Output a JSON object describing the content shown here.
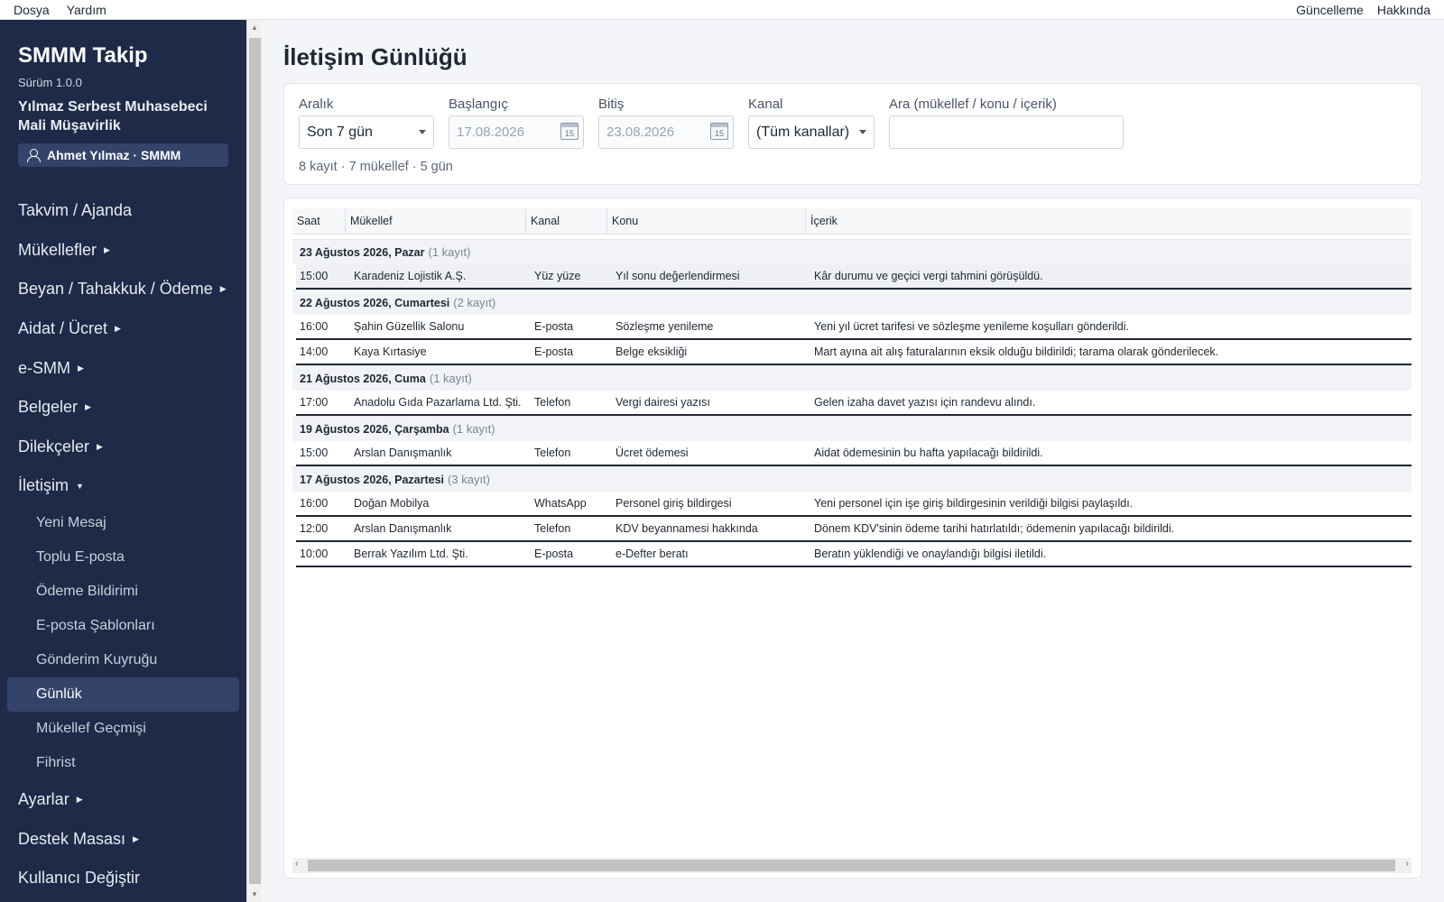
{
  "menubar": {
    "file": "Dosya",
    "help": "Yardım",
    "update": "Güncelleme",
    "about": "Hakkında"
  },
  "sidebar": {
    "app_title": "SMMM Takip",
    "version": "Sürüm 1.0.0",
    "firm_line1": "Yılmaz Serbest Muhasebeci",
    "firm_line2": "Mali Müşavirlik",
    "user": "Ahmet Yılmaz · SMMM",
    "items": [
      {
        "label": "Takvim / Ajanda"
      },
      {
        "label": "Mükellefler"
      },
      {
        "label": "Beyan / Tahakkuk / Ödeme"
      },
      {
        "label": "Aidat / Ücret"
      },
      {
        "label": "e-SMM"
      },
      {
        "label": "Belgeler"
      },
      {
        "label": "Dilekçeler"
      },
      {
        "label": "İletişim"
      },
      {
        "label": "Ayarlar"
      },
      {
        "label": "Destek Masası"
      },
      {
        "label": "Kullanıcı Değiştir"
      }
    ],
    "sub_items": [
      {
        "label": "Yeni Mesaj"
      },
      {
        "label": "Toplu E-posta"
      },
      {
        "label": "Ödeme Bildirimi"
      },
      {
        "label": "E-posta Şablonları"
      },
      {
        "label": "Gönderim Kuyruğu"
      },
      {
        "label": "Günlük"
      },
      {
        "label": "Mükellef Geçmişi"
      },
      {
        "label": "Fihrist"
      }
    ]
  },
  "page": {
    "title": "İletişim Günlüğü"
  },
  "filters": {
    "range_label": "Aralık",
    "range_value": "Son 7 gün",
    "start_label": "Başlangıç",
    "start_value": "17.08.2026",
    "end_label": "Bitiş",
    "end_value": "23.08.2026",
    "channel_label": "Kanal",
    "channel_value": "(Tüm kanallar)",
    "search_label": "Ara (mükellef / konu / içerik)",
    "search_value": "",
    "calendar_day": "15",
    "summary": "8 kayıt · 7 mükellef · 5 gün"
  },
  "table": {
    "headers": {
      "time": "Saat",
      "client": "Mükellef",
      "channel": "Kanal",
      "subject": "Konu",
      "content": "İçerik"
    },
    "groups": [
      {
        "date": "23 Ağustos 2026, Pazar",
        "count": "(1 kayıt)",
        "rows": [
          {
            "time": "15:00",
            "client": "Karadeniz Lojistik A.Ş.",
            "channel": "Yüz yüze",
            "subject": "Yıl sonu değerlendirmesi",
            "content": "Kâr durumu ve geçici vergi tahmini görüşüldü."
          }
        ]
      },
      {
        "date": "22 Ağustos 2026, Cumartesi",
        "count": "(2 kayıt)",
        "rows": [
          {
            "time": "16:00",
            "client": "Şahin Güzellik Salonu",
            "channel": "E-posta",
            "subject": "Sözleşme yenileme",
            "content": "Yeni yıl ücret tarifesi ve sözleşme yenileme koşulları gönderildi."
          },
          {
            "time": "14:00",
            "client": "Kaya Kırtasiye",
            "channel": "E-posta",
            "subject": "Belge eksikliği",
            "content": "Mart ayına ait alış faturalarının eksik olduğu bildirildi; tarama olarak gönderilecek."
          }
        ]
      },
      {
        "date": "21 Ağustos 2026, Cuma",
        "count": "(1 kayıt)",
        "rows": [
          {
            "time": "17:00",
            "client": "Anadolu Gıda Pazarlama Ltd. Şti.",
            "channel": "Telefon",
            "subject": "Vergi dairesi yazısı",
            "content": "Gelen izaha davet yazısı için randevu alındı."
          }
        ]
      },
      {
        "date": "19 Ağustos 2026, Çarşamba",
        "count": "(1 kayıt)",
        "rows": [
          {
            "time": "15:00",
            "client": "Arslan Danışmanlık",
            "channel": "Telefon",
            "subject": "Ücret ödemesi",
            "content": "Aidat ödemesinin bu hafta yapılacağı bildirildi."
          }
        ]
      },
      {
        "date": "17 Ağustos 2026, Pazartesi",
        "count": "(3 kayıt)",
        "rows": [
          {
            "time": "16:00",
            "client": "Doğan Mobilya",
            "channel": "WhatsApp",
            "subject": "Personel giriş bildirgesi",
            "content": "Yeni personel için işe giriş bildirgesinin verildiği bilgisi paylaşıldı."
          },
          {
            "time": "12:00",
            "client": "Arslan Danışmanlık",
            "channel": "Telefon",
            "subject": "KDV beyannamesi hakkında",
            "content": "Dönem KDV'sinin ödeme tarihi hatırlatıldı; ödemenin yapılacağı bildirildi."
          },
          {
            "time": "10:00",
            "client": "Berrak Yazılım Ltd. Şti.",
            "channel": "E-posta",
            "subject": "e-Defter beratı",
            "content": "Beratın yüklendiği ve onaylandığı bilgisi iletildi."
          }
        ]
      }
    ]
  }
}
